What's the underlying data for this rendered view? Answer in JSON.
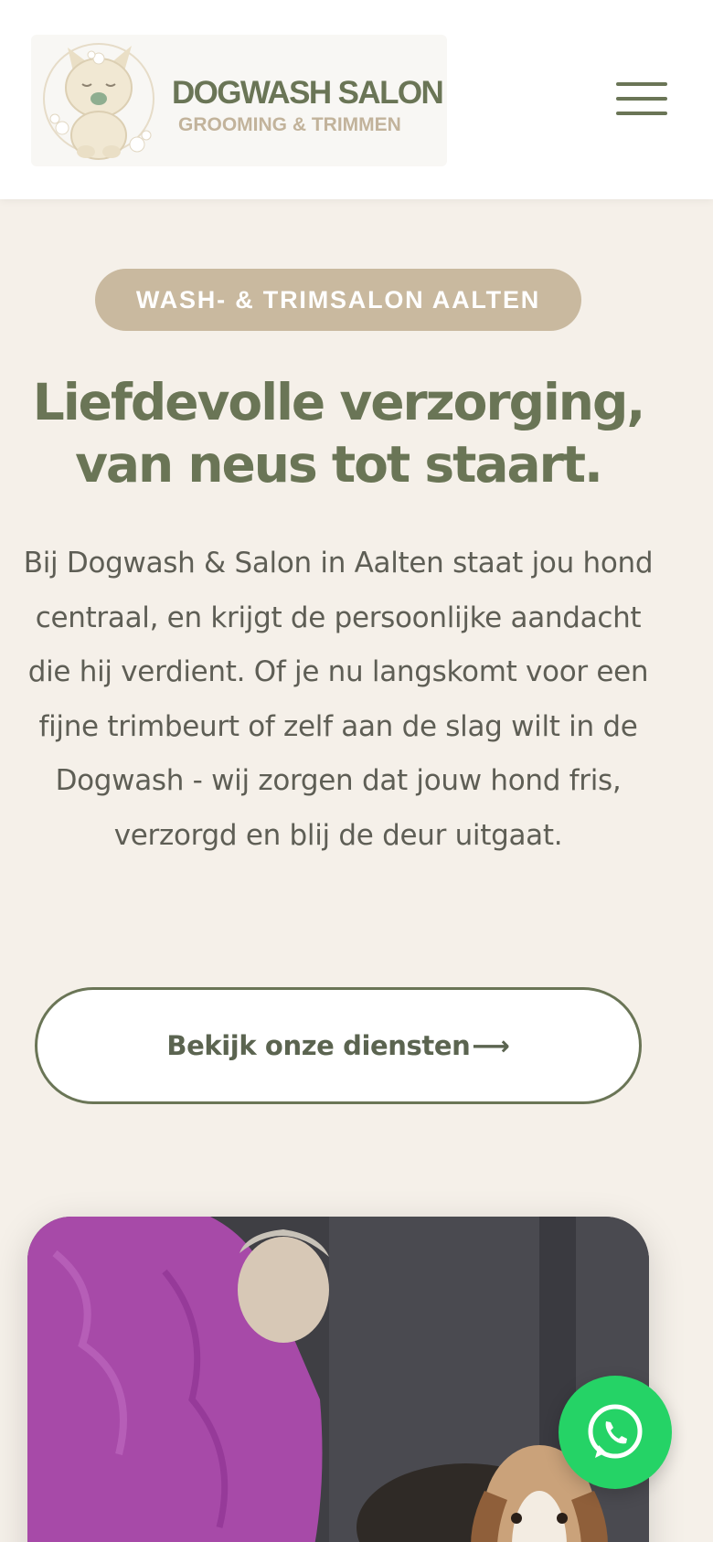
{
  "brand": {
    "name": "DOGWASH SALON",
    "tagline": "GROOMING & TRIMMEN",
    "logo_icon": "dog-mascot-icon"
  },
  "nav": {
    "menu_icon": "hamburger-menu-icon"
  },
  "hero": {
    "badge": "WASH- & TRIMSALON AALTEN",
    "title_line1": "Liefdevolle verzorging,",
    "title_line2": "van neus tot staart.",
    "description": "Bij Dogwash & Salon in Aalten staat jou hond centraal, en krijgt de persoonlijke aandacht die hij verdient. Of je nu langskomt voor een fijne trimbeurt of zelf aan de slag wilt in de Dogwash - wij zorgen dat jouw hond fris, verzorgd en blij de deur uitgaat.",
    "cta_label": "Bekijk onze diensten",
    "cta_icon": "arrow-right-icon"
  },
  "floating": {
    "whatsapp_icon": "whatsapp-icon"
  },
  "colors": {
    "primary": "#6a7556",
    "accent": "#c9b99f",
    "background": "#f5f0e9",
    "whatsapp": "#25d366"
  }
}
